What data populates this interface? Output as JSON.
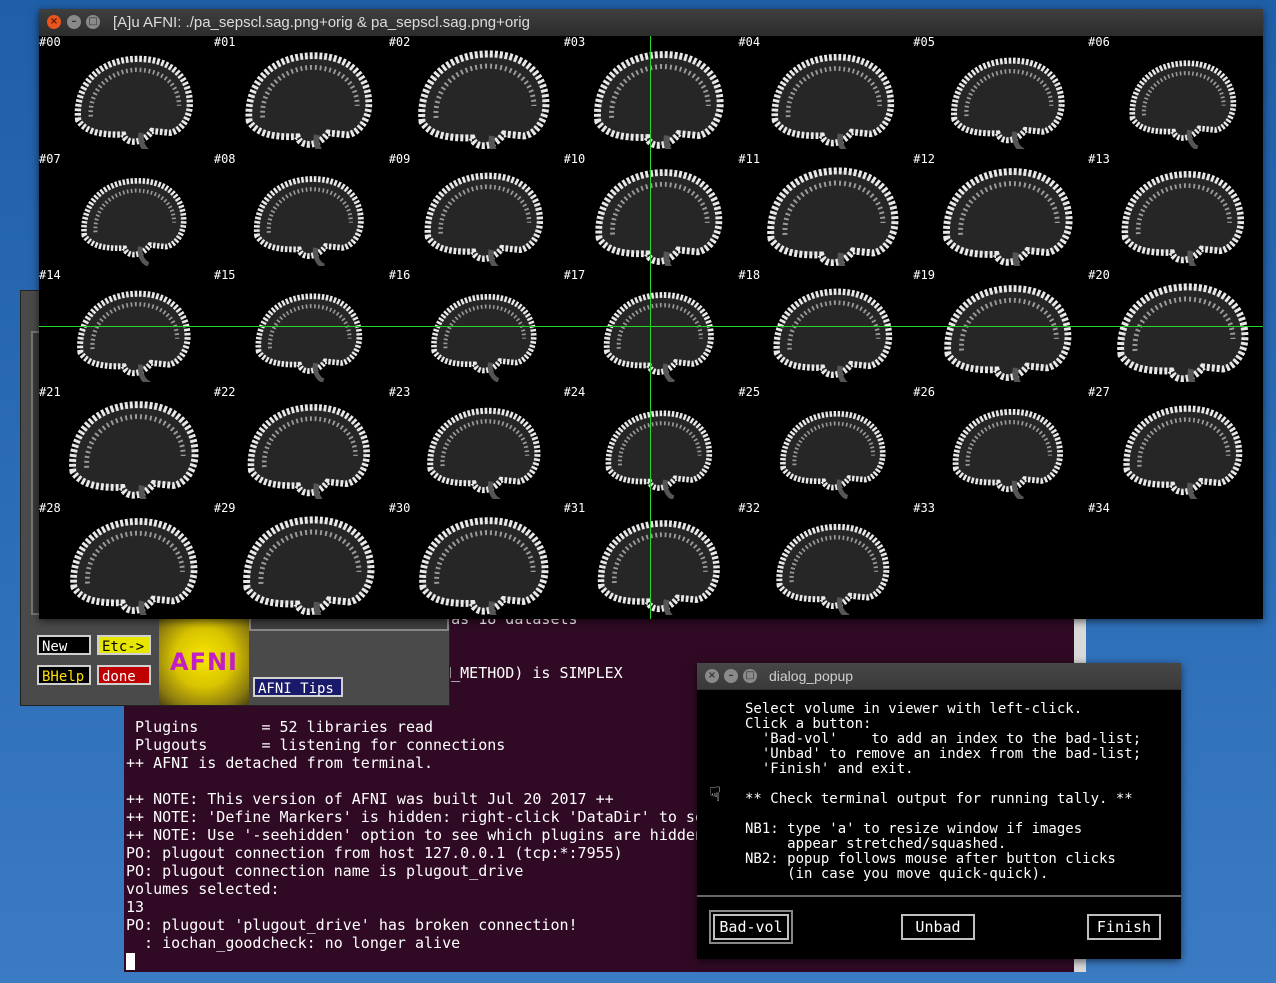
{
  "main_window": {
    "title": "[A]u AFNI: ./pa_sepscl.sag.png+orig & pa_sepscl.sag.png+orig",
    "slices": [
      "#00",
      "#01",
      "#02",
      "#03",
      "#04",
      "#05",
      "#06",
      "#07",
      "#08",
      "#09",
      "#10",
      "#11",
      "#12",
      "#13",
      "#14",
      "#15",
      "#16",
      "#17",
      "#18",
      "#19",
      "#20",
      "#21",
      "#22",
      "#23",
      "#24",
      "#25",
      "#26",
      "#27",
      "#28",
      "#29",
      "#30",
      "#31",
      "#32",
      "#33",
      "#34"
    ],
    "crosshair_color": "#27d827"
  },
  "afni_panel": {
    "new_label": "New",
    "etc_label": "Etc->",
    "bhelp_label": "BHelp",
    "done_label": "done",
    "logo_text": "AFNI",
    "tips_label": "AFNI Tips"
  },
  "terminal": {
    "lines": [
      "                                 s has 18 datasets",
      "",
      "",
      "                                 FIM_METHOD) is SIMPLEX",
      "",
      "",
      " Plugins       = 52 libraries read",
      " Plugouts      = listening for connections",
      "++ AFNI is detached from terminal.",
      "",
      "++ NOTE: This version of AFNI was built Jul 20 2017 ++",
      "++ NOTE: 'Define Markers' is hidden: right-click 'DataDir' to se",
      "++ NOTE: Use '-seehidden' option to see which plugins are hidden",
      "PO: plugout connection from host 127.0.0.1 (tcp:*:7955)",
      "PO: plugout connection name is plugout_drive",
      "volumes selected:",
      "13",
      "PO: plugout 'plugout_drive' has broken connection!",
      "  : iochan_goodcheck: no longer alive"
    ]
  },
  "dialog": {
    "title": "dialog_popup",
    "message": "Select volume in viewer with left-click.\nClick a button:\n  'Bad-vol'    to add an index to the bad-list;\n  'Unbad' to remove an index from the bad-list;\n  'Finish' and exit.\n\n** Check terminal output for running tally. **\n\nNB1: type 'a' to resize window if images\n     appear stretched/squashed.\nNB2: popup follows mouse after button clicks\n     (in case you move quick-quick).",
    "icon": "mouse-pointer-icon",
    "buttons": {
      "bad_vol": "Bad-vol",
      "unbad": "Unbad",
      "finish": "Finish"
    }
  }
}
